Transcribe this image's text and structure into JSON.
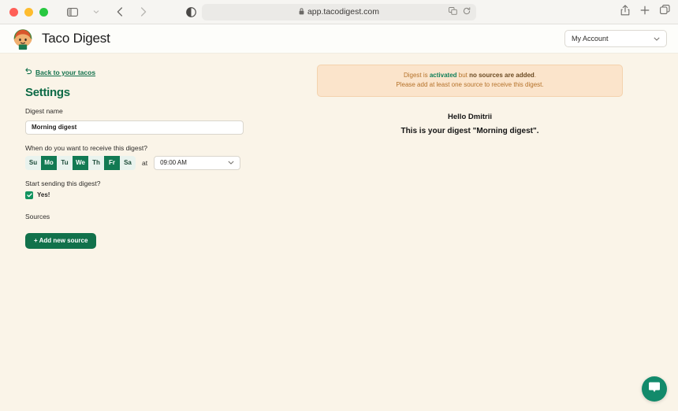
{
  "browser": {
    "url": "app.tacodigest.com",
    "lock_icon": "lock-icon",
    "back_icon": "back-arrow-icon",
    "forward_icon": "forward-arrow-icon",
    "sidebar_icon": "sidebar-toggle-icon",
    "sidebar_chevron_icon": "chevron-down-icon",
    "shield_icon": "reader-contrast-icon",
    "translate_icon": "translate-icon",
    "reload_icon": "reload-icon",
    "share_icon": "share-icon",
    "new_tab_icon": "plus-icon",
    "tabs_icon": "tab-overview-icon"
  },
  "app_header": {
    "brand_name": "Taco Digest",
    "logo_icon": "taco-logo-icon",
    "account_label": "My Account",
    "account_chevron_icon": "chevron-down-icon"
  },
  "settings": {
    "back_link_label": "Back to your tacos",
    "back_link_icon": "undo-arrow-icon",
    "title": "Settings",
    "digest_name_label": "Digest name",
    "digest_name_value": "Morning digest",
    "digest_name_placeholder": "Digest name",
    "schedule_label": "When do you want to receive this digest?",
    "days": [
      {
        "label": "Su",
        "selected": false
      },
      {
        "label": "Mo",
        "selected": true
      },
      {
        "label": "Tu",
        "selected": false
      },
      {
        "label": "We",
        "selected": true
      },
      {
        "label": "Th",
        "selected": false
      },
      {
        "label": "Fr",
        "selected": true
      },
      {
        "label": "Sa",
        "selected": false
      }
    ],
    "at_label": "at",
    "time_value": "09:00 AM",
    "time_chevron_icon": "chevron-down-icon",
    "start_sending_label": "Start sending this digest?",
    "start_sending_checked": true,
    "start_sending_checkbox_icon": "checkmark-icon",
    "start_sending_value_label": "Yes!",
    "sources_label": "Sources",
    "add_source_button": "+ Add new source"
  },
  "alert": {
    "line1_part1": "Digest is ",
    "line1_emphasis_green": "activated",
    "line1_part2": " but ",
    "line1_emphasis_dark": "no sources are added",
    "line1_part3": ".",
    "line2": "Please add at least one source to receive this digest."
  },
  "preview": {
    "greeting": "Hello Dmitrii",
    "digest_line": "This is your digest \"Morning digest\"."
  },
  "chat": {
    "icon": "chat-bubble-icon"
  },
  "colors": {
    "brand_green": "#11714b",
    "accent_green": "#12935f",
    "page_bg": "#faf4e8",
    "alert_bg": "#fbe4cb",
    "alert_text": "#b5722a",
    "chat_fab": "#128a6b"
  }
}
